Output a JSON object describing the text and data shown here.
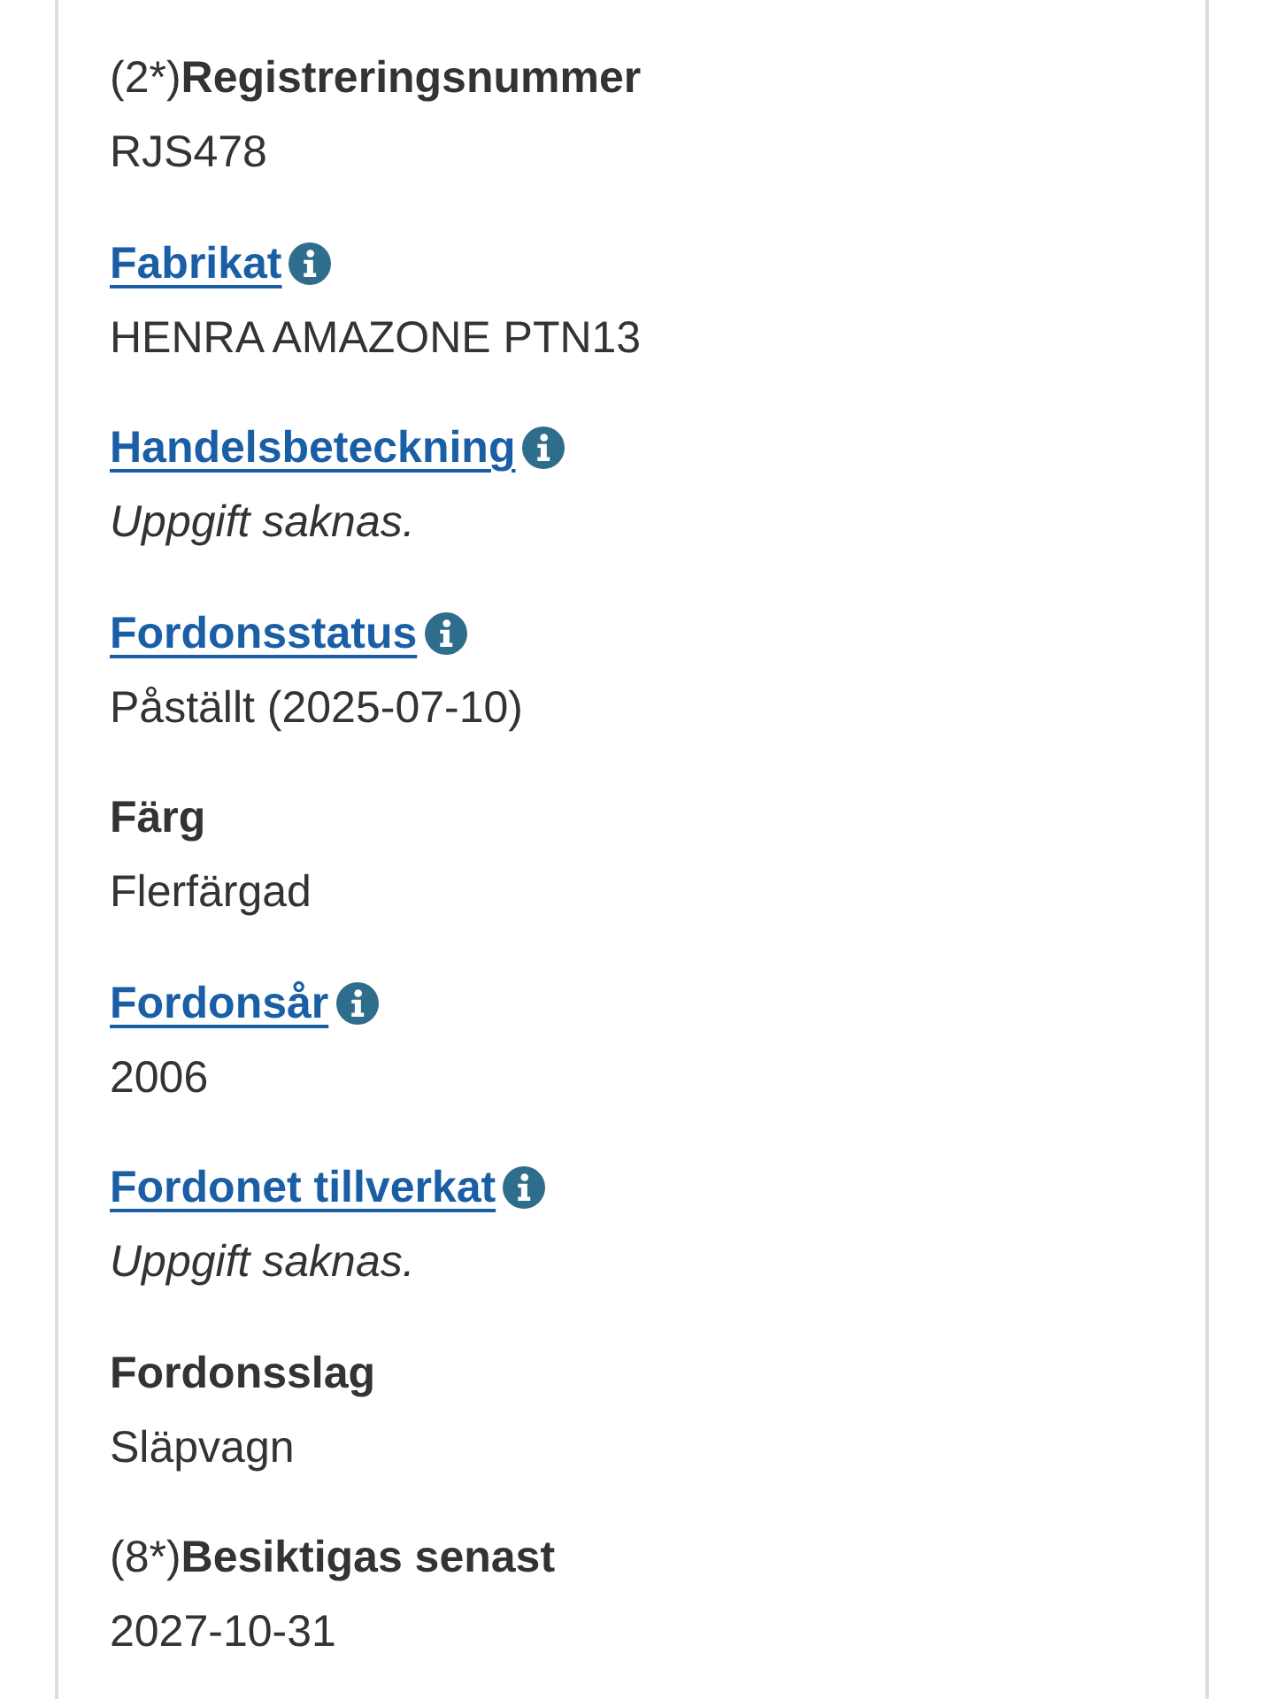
{
  "fields": [
    {
      "kind": "plain",
      "note": "(2*)",
      "label": "Registreringsnummer",
      "value": "RJS478",
      "missing": false
    },
    {
      "kind": "link",
      "label": "Fabrikat",
      "value": "HENRA AMAZONE PTN13",
      "missing": false
    },
    {
      "kind": "link",
      "label": "Handelsbeteckning",
      "value": "Uppgift saknas.",
      "missing": true
    },
    {
      "kind": "link",
      "label": "Fordonsstatus",
      "value": "Påställt (2025-07-10)",
      "missing": false
    },
    {
      "kind": "plain",
      "label": "Färg",
      "value": "Flerfärgad",
      "missing": false
    },
    {
      "kind": "link",
      "label": "Fordonsår",
      "value": "2006",
      "missing": false
    },
    {
      "kind": "link",
      "label": "Fordonet tillverkat",
      "value": "Uppgift saknas.",
      "missing": true
    },
    {
      "kind": "plain",
      "label": "Fordonsslag",
      "value": "Släpvagn",
      "missing": false
    },
    {
      "kind": "plain",
      "note": "(8*)",
      "label": "Besiktigas senast",
      "value": "2027-10-31",
      "missing": false
    }
  ]
}
